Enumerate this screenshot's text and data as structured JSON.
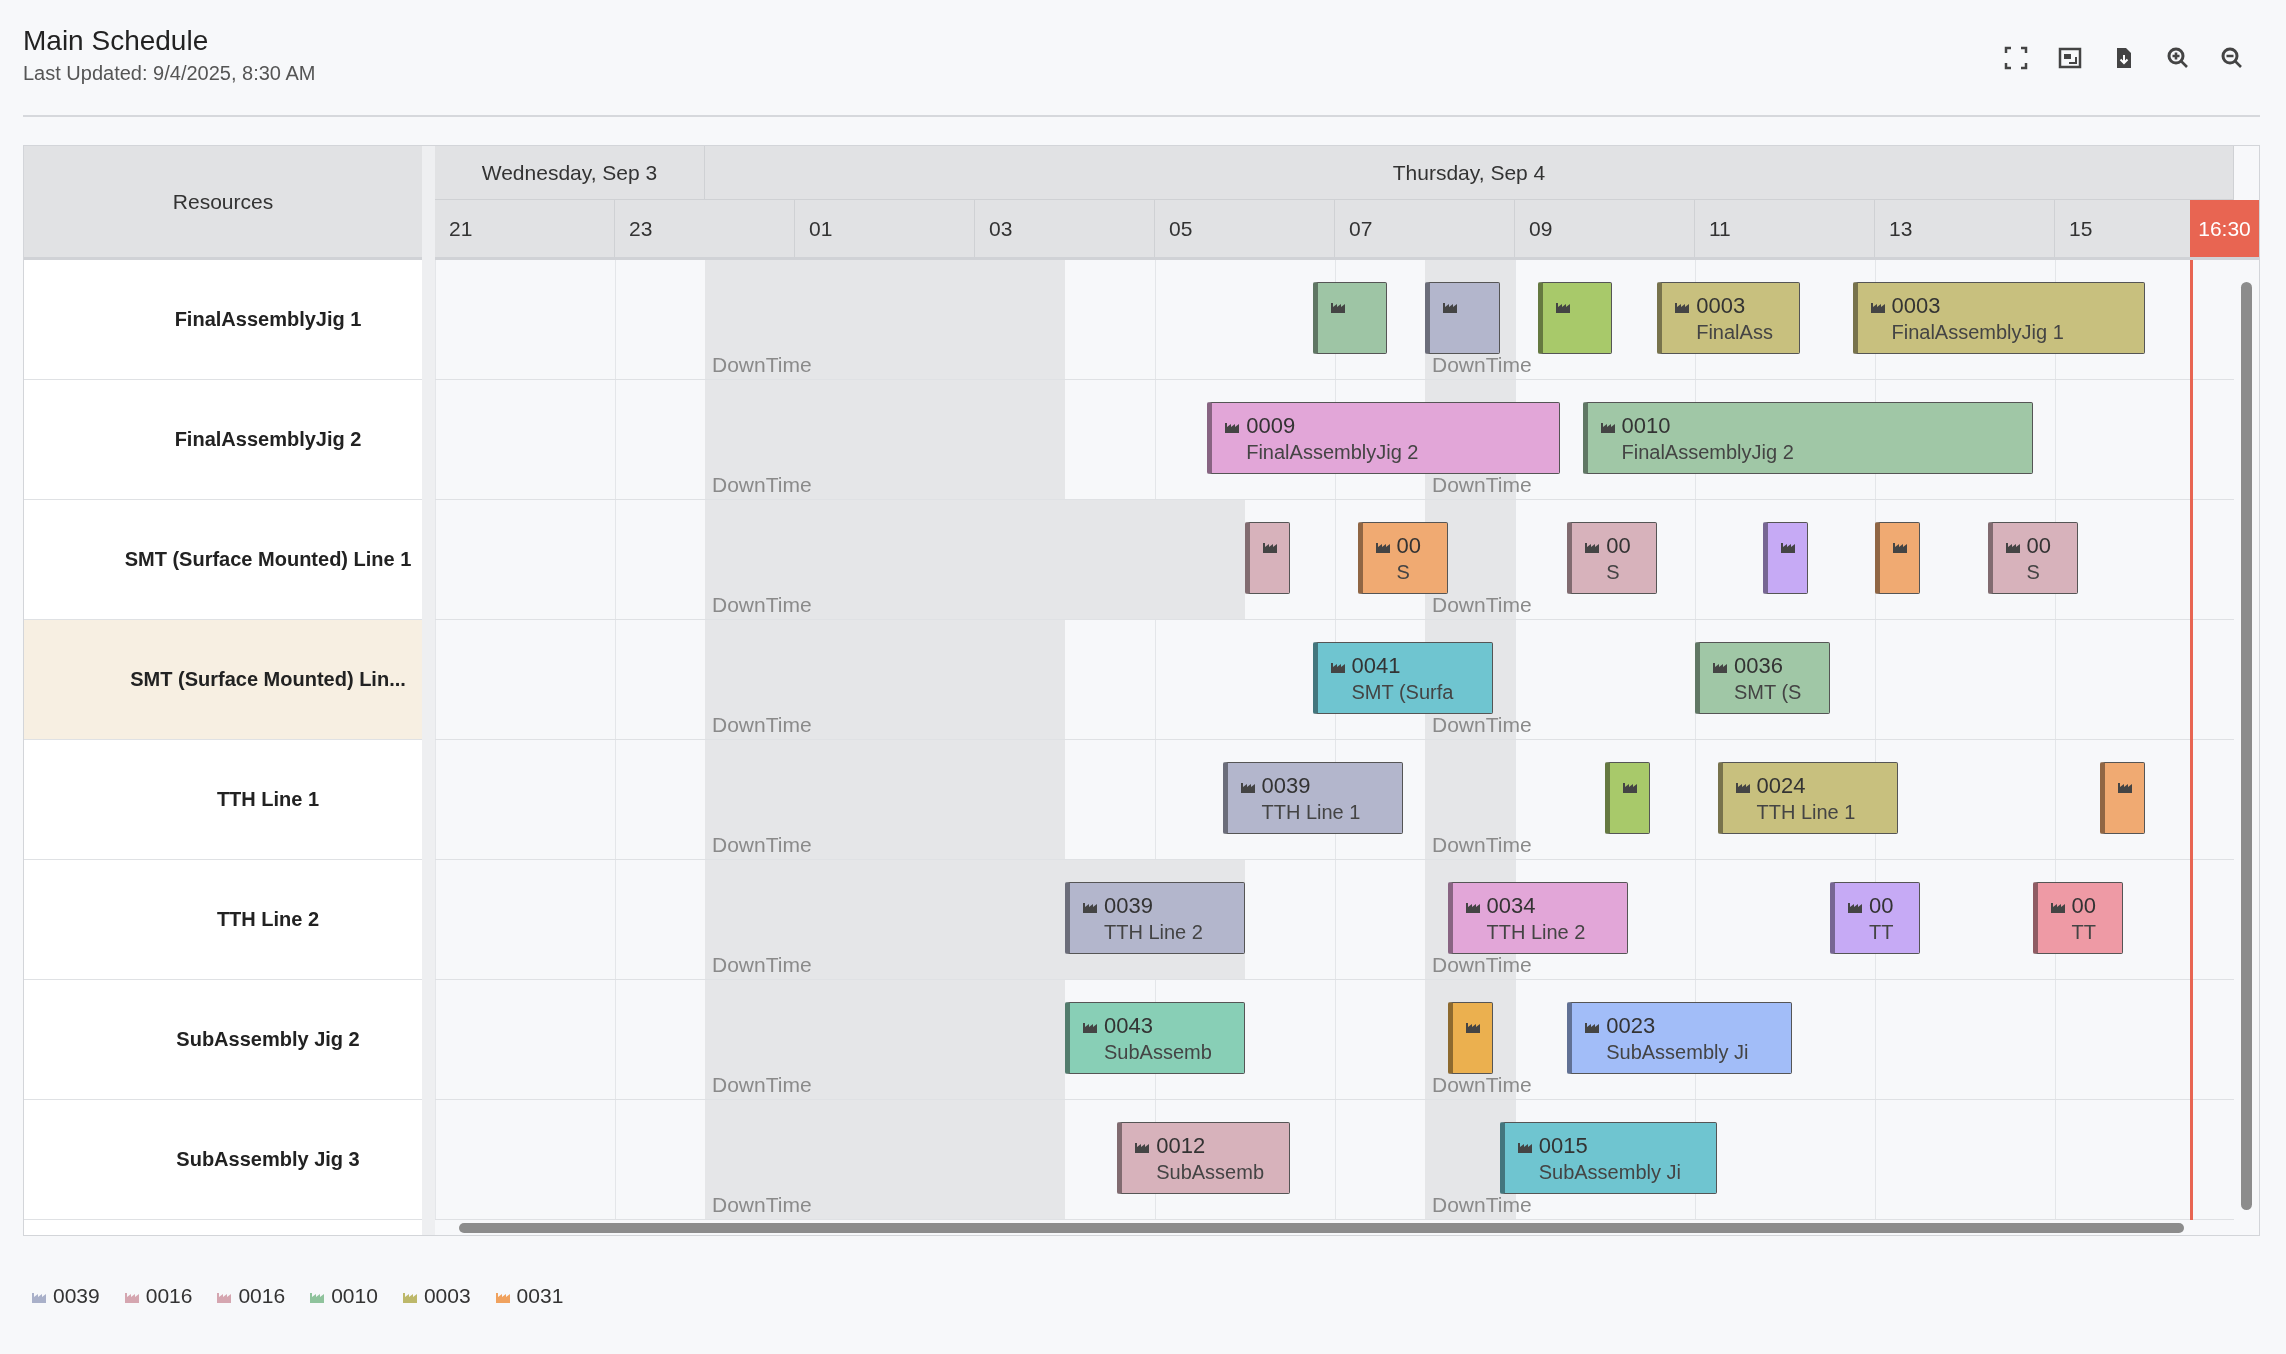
{
  "header": {
    "title": "Main Schedule",
    "subtitle": "Last Updated: 9/4/2025, 8:30 AM"
  },
  "toolbar": [
    {
      "kind": "fullscreen"
    },
    {
      "kind": "image"
    },
    {
      "kind": "download"
    },
    {
      "kind": "zoom-in"
    },
    {
      "kind": "zoom-out"
    }
  ],
  "resources_header": "Resources",
  "timeline": {
    "days": [
      {
        "label": "Wednesday, Sep 3"
      },
      {
        "label": "Thursday, Sep 4"
      }
    ],
    "ticks": [
      {
        "label": "21"
      },
      {
        "label": "23"
      },
      {
        "label": "01"
      },
      {
        "label": "03"
      },
      {
        "label": "05"
      },
      {
        "label": "07"
      },
      {
        "label": "09"
      },
      {
        "label": "11"
      },
      {
        "label": "13"
      },
      {
        "label": "15"
      }
    ],
    "now": {
      "label": "16:30"
    }
  },
  "resources": [
    {
      "name": "FinalAssemblyJig 1",
      "selected": false,
      "downtimes": [
        {
          "label": "DownTime"
        },
        {
          "label": "DownTime"
        }
      ],
      "tasks": [
        {
          "color": "#9ec5a5"
        },
        {
          "color": "#b3b6cc"
        },
        {
          "color": "#a8c96a"
        },
        {
          "code": "0003",
          "name": "FinalAss",
          "color": "#c8c07e"
        },
        {
          "code": "0003",
          "name": "FinalAssemblyJig 1",
          "color": "#c8c07e"
        }
      ]
    },
    {
      "name": "FinalAssemblyJig 2",
      "selected": false,
      "downtimes": [
        {
          "label": "DownTime"
        },
        {
          "label": "DownTime"
        }
      ],
      "tasks": [
        {
          "code": "0009",
          "name": "FinalAssemblyJig 2",
          "color": "#e2a6d8"
        },
        {
          "code": "0010",
          "name": "FinalAssemblyJig 2",
          "color": "#a0c7a6"
        }
      ]
    },
    {
      "name": "SMT (Surface Mounted) Line 1",
      "selected": false,
      "downtimes": [
        {
          "label": "DownTime"
        },
        {
          "label": "DownTime"
        }
      ],
      "tasks": [
        {
          "color": "#d7b2bb"
        },
        {
          "code": "00",
          "name": "S",
          "color": "#f0aa72"
        },
        {
          "code": "00",
          "name": "S",
          "color": "#d7b2bb"
        },
        {
          "color": "#c6aaf5"
        },
        {
          "color": "#f0aa72"
        },
        {
          "code": "00",
          "name": "S",
          "color": "#d7b2bb"
        }
      ]
    },
    {
      "name": "SMT (Surface Mounted) Lin...",
      "selected": true,
      "downtimes": [
        {
          "label": "DownTime"
        },
        {
          "label": "DownTime"
        }
      ],
      "tasks": [
        {
          "code": "0041",
          "name": "SMT (Surfa",
          "color": "#6fc5d0"
        },
        {
          "code": "0036",
          "name": "SMT (S",
          "color": "#a0c7a6"
        }
      ]
    },
    {
      "name": "TTH Line 1",
      "selected": false,
      "downtimes": [
        {
          "label": "DownTime"
        },
        {
          "label": "DownTime"
        }
      ],
      "tasks": [
        {
          "code": "0039",
          "name": "TTH Line 1",
          "color": "#b3b6cc"
        },
        {
          "color": "#a8c96a"
        },
        {
          "code": "0024",
          "name": "TTH Line 1",
          "color": "#c8c07e"
        },
        {
          "color": "#f0aa72"
        }
      ]
    },
    {
      "name": "TTH Line 2",
      "selected": false,
      "downtimes": [
        {
          "label": "DownTime"
        },
        {
          "label": "DownTime"
        }
      ],
      "tasks": [
        {
          "code": "0039",
          "name": "TTH Line 2",
          "color": "#b3b6cc"
        },
        {
          "code": "0034",
          "name": "TTH Line 2",
          "color": "#e2a6d8"
        },
        {
          "code": "00",
          "name": "TT",
          "color": "#c6aaf5"
        },
        {
          "code": "00",
          "name": "TT",
          "color": "#ee9aa5"
        }
      ]
    },
    {
      "name": "SubAssembly Jig 2",
      "selected": false,
      "downtimes": [
        {
          "label": "DownTime"
        },
        {
          "label": "DownTime"
        }
      ],
      "tasks": [
        {
          "code": "0043",
          "name": "SubAssemb",
          "color": "#88cfb6"
        },
        {
          "color": "#ebb04f"
        },
        {
          "code": "0023",
          "name": "SubAssembly Ji",
          "color": "#a2bdf8"
        }
      ]
    },
    {
      "name": "SubAssembly Jig 3",
      "selected": false,
      "downtimes": [
        {
          "label": "DownTime"
        },
        {
          "label": "DownTime"
        }
      ],
      "tasks": [
        {
          "code": "0012",
          "name": "SubAssemb",
          "color": "#d7b2bb"
        },
        {
          "code": "0015",
          "name": "SubAssembly Ji",
          "color": "#6fc5d0"
        }
      ]
    }
  ],
  "legend": [
    {
      "code": "0039",
      "color": "#a9b0c9"
    },
    {
      "code": "0016",
      "color": "#d5a6b0"
    },
    {
      "code": "0016",
      "color": "#d5a6b0"
    },
    {
      "code": "0010",
      "color": "#8fc39c"
    },
    {
      "code": "0003",
      "color": "#bdb86a"
    },
    {
      "code": "0031",
      "color": "#f0a25e"
    }
  ]
}
